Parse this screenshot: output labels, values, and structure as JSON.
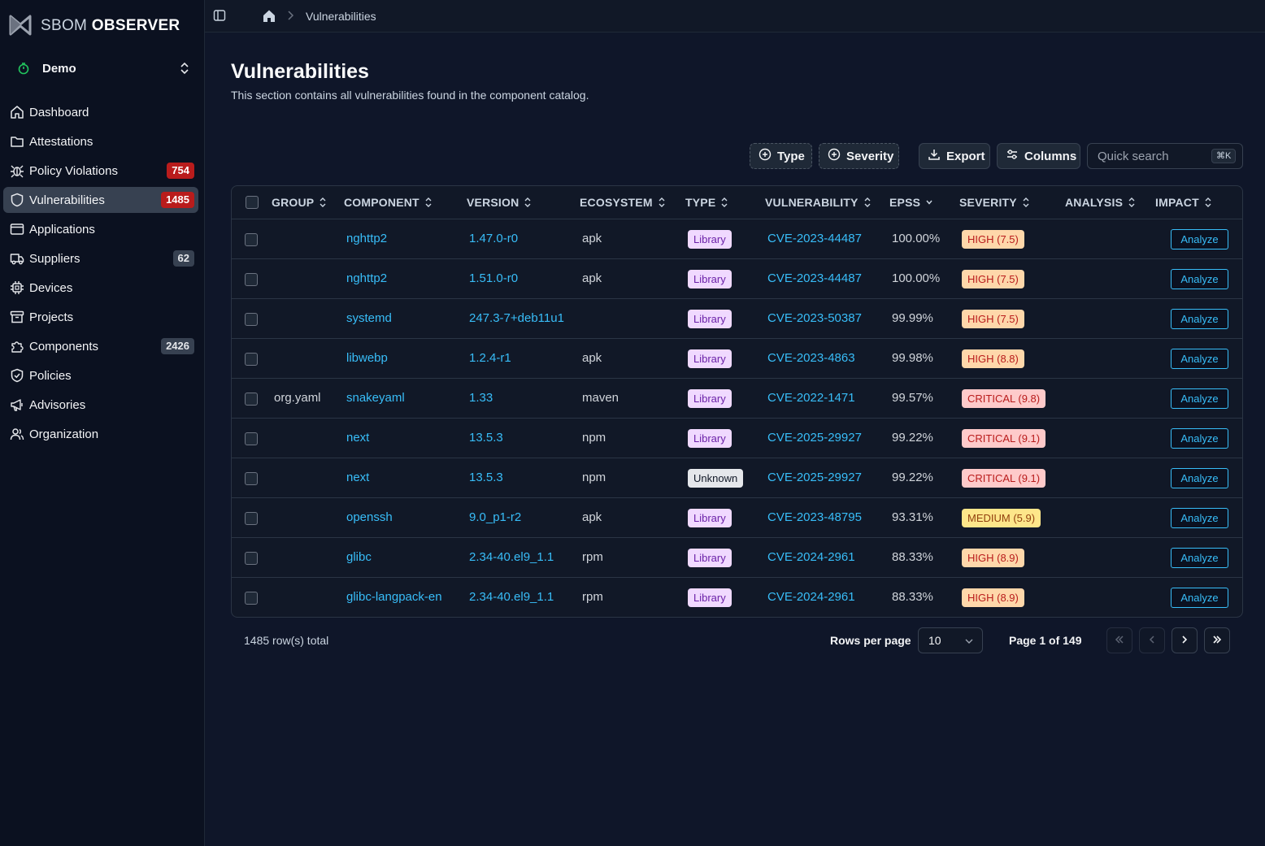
{
  "brand": {
    "name_part1": "SBOM",
    "name_part2": "OBSERVER"
  },
  "org": {
    "name": "Demo"
  },
  "sidebar": {
    "items": [
      {
        "label": "Dashboard",
        "icon": "home-icon",
        "badge": null,
        "active": false
      },
      {
        "label": "Attestations",
        "icon": "folder-icon",
        "badge": null,
        "active": false
      },
      {
        "label": "Policy Violations",
        "icon": "bug-icon",
        "badge": "754",
        "badge_color": "red",
        "active": false
      },
      {
        "label": "Vulnerabilities",
        "icon": "shield-icon",
        "badge": "1485",
        "badge_color": "red",
        "active": true
      },
      {
        "label": "Applications",
        "icon": "window-icon",
        "badge": null,
        "active": false
      },
      {
        "label": "Suppliers",
        "icon": "truck-icon",
        "badge": "62",
        "badge_color": "gray",
        "active": false
      },
      {
        "label": "Devices",
        "icon": "chip-icon",
        "badge": null,
        "active": false
      },
      {
        "label": "Projects",
        "icon": "archive-icon",
        "badge": null,
        "active": false
      },
      {
        "label": "Components",
        "icon": "puzzle-icon",
        "badge": "2426",
        "badge_color": "gray",
        "active": false
      },
      {
        "label": "Policies",
        "icon": "shield-check-icon",
        "badge": null,
        "active": false
      },
      {
        "label": "Advisories",
        "icon": "megaphone-icon",
        "badge": null,
        "active": false
      },
      {
        "label": "Organization",
        "icon": "users-icon",
        "badge": null,
        "active": false
      }
    ]
  },
  "breadcrumb": {
    "current": "Vulnerabilities"
  },
  "page": {
    "title": "Vulnerabilities",
    "subtitle": "This section contains all vulnerabilities found in the component catalog."
  },
  "toolbar": {
    "type_filter": "Type",
    "severity_filter": "Severity",
    "export": "Export",
    "columns": "Columns",
    "search_placeholder": "Quick search",
    "search_shortcut": "⌘K"
  },
  "table": {
    "columns": [
      "GROUP",
      "COMPONENT",
      "VERSION",
      "ECOSYSTEM",
      "TYPE",
      "VULNERABILITY",
      "EPSS",
      "SEVERITY",
      "ANALYSIS",
      "IMPACT"
    ],
    "action_label": "Analyze",
    "rows": [
      {
        "group": "",
        "component": "nghttp2",
        "version": "1.47.0-r0",
        "ecosystem": "apk",
        "type": "Library",
        "vulnerability": "CVE-2023-44487",
        "epss": "100.00%",
        "severity": "HIGH (7.5)",
        "severity_level": "high",
        "analysis": ""
      },
      {
        "group": "",
        "component": "nghttp2",
        "version": "1.51.0-r0",
        "ecosystem": "apk",
        "type": "Library",
        "vulnerability": "CVE-2023-44487",
        "epss": "100.00%",
        "severity": "HIGH (7.5)",
        "severity_level": "high",
        "analysis": ""
      },
      {
        "group": "",
        "component": "systemd",
        "version": "247.3-7+deb11u1",
        "ecosystem": "",
        "type": "Library",
        "vulnerability": "CVE-2023-50387",
        "epss": "99.99%",
        "severity": "HIGH (7.5)",
        "severity_level": "high",
        "analysis": ""
      },
      {
        "group": "",
        "component": "libwebp",
        "version": "1.2.4-r1",
        "ecosystem": "apk",
        "type": "Library",
        "vulnerability": "CVE-2023-4863",
        "epss": "99.98%",
        "severity": "HIGH (8.8)",
        "severity_level": "high",
        "analysis": ""
      },
      {
        "group": "org.yaml",
        "component": "snakeyaml",
        "version": "1.33",
        "ecosystem": "maven",
        "type": "Library",
        "vulnerability": "CVE-2022-1471",
        "epss": "99.57%",
        "severity": "CRITICAL (9.8)",
        "severity_level": "critical",
        "analysis": ""
      },
      {
        "group": "",
        "component": "next",
        "version": "13.5.3",
        "ecosystem": "npm",
        "type": "Library",
        "vulnerability": "CVE-2025-29927",
        "epss": "99.22%",
        "severity": "CRITICAL (9.1)",
        "severity_level": "critical",
        "analysis": ""
      },
      {
        "group": "",
        "component": "next",
        "version": "13.5.3",
        "ecosystem": "npm",
        "type": "Unknown",
        "vulnerability": "CVE-2025-29927",
        "epss": "99.22%",
        "severity": "CRITICAL (9.1)",
        "severity_level": "critical",
        "analysis": ""
      },
      {
        "group": "",
        "component": "openssh",
        "version": "9.0_p1-r2",
        "ecosystem": "apk",
        "type": "Library",
        "vulnerability": "CVE-2023-48795",
        "epss": "93.31%",
        "severity": "MEDIUM (5.9)",
        "severity_level": "medium",
        "analysis": ""
      },
      {
        "group": "",
        "component": "glibc",
        "version": "2.34-40.el9_1.1",
        "ecosystem": "rpm",
        "type": "Library",
        "vulnerability": "CVE-2024-2961",
        "epss": "88.33%",
        "severity": "HIGH (8.9)",
        "severity_level": "high",
        "analysis": ""
      },
      {
        "group": "",
        "component": "glibc-langpack-en",
        "version": "2.34-40.el9_1.1",
        "ecosystem": "rpm",
        "type": "Library",
        "vulnerability": "CVE-2024-2961",
        "epss": "88.33%",
        "severity": "HIGH (8.9)",
        "severity_level": "high",
        "analysis": ""
      }
    ]
  },
  "pagination": {
    "total": "1485 row(s) total",
    "rows_per_page_label": "Rows per page",
    "rows_per_page": "10",
    "page_info": "Page 1 of 149"
  },
  "colors": {
    "accent_link": "#38bdf8",
    "badge_red": "#b91c1c",
    "sidebar_bg": "#0b1120",
    "main_bg": "#0f1629"
  }
}
